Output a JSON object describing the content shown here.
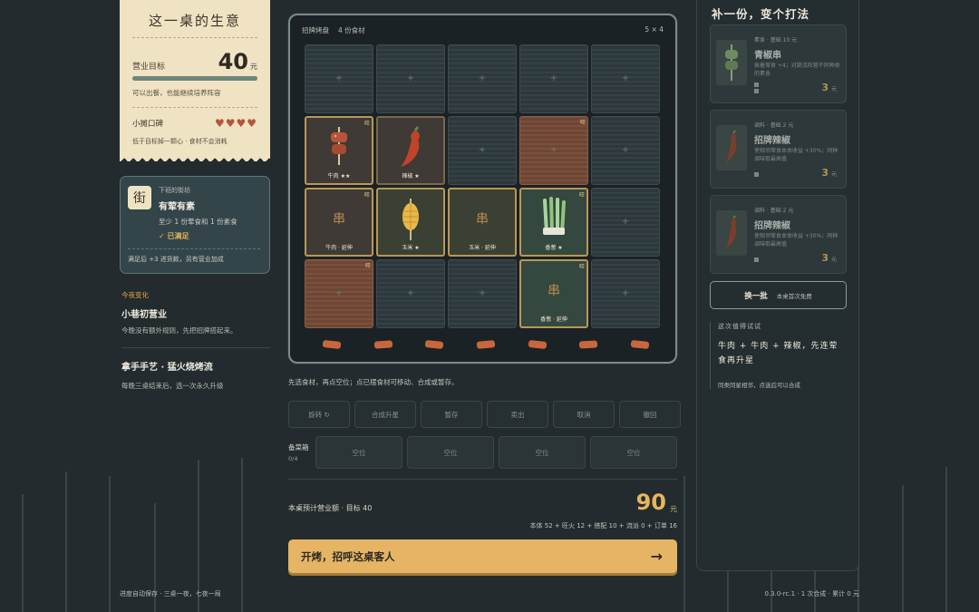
{
  "ticket": {
    "title": "这一桌的生意",
    "goal_label": "营业目标",
    "goal_value": "40",
    "goal_unit": "元",
    "goal_progress": 1.0,
    "goal_note": "可以出餐，也能继续培养阵容",
    "reputation_label": "小摊口碑",
    "hearts": "♥♥♥♥",
    "reputation_note": "低于目标掉一颗心 · 食材不会消耗"
  },
  "street": {
    "badge": "街",
    "small": "下班的街坊",
    "name": "有荤有素",
    "requirement": "至少 1 份荤食和 1 份素食",
    "status": "✓ 已满足",
    "bonus": "满足后 +3 进货款，另有营业加成"
  },
  "tonight": {
    "tag": "今夜变化",
    "title": "小巷初营业",
    "desc": "今晚没有额外规则，先把招牌搭起来。",
    "skill_title": "拿手手艺 · 猛火烧烤流",
    "skill_desc": "每晚三桌结束后，选一次永久升级"
  },
  "board": {
    "title": "招牌烤盘",
    "count": "4 份食材",
    "size": "5 × 4",
    "cells": [
      {
        "type": "empty"
      },
      {
        "type": "empty"
      },
      {
        "type": "empty"
      },
      {
        "type": "empty"
      },
      {
        "type": "empty"
      },
      {
        "type": "food",
        "style": "",
        "icon": "skewer-meat",
        "label": "牛肉 ★★",
        "corner": "旺"
      },
      {
        "type": "food",
        "style": "plain",
        "icon": "chili",
        "label": "辣椒 ★",
        "corner": ""
      },
      {
        "type": "empty"
      },
      {
        "type": "wood",
        "corner": "旺"
      },
      {
        "type": "empty"
      },
      {
        "type": "food",
        "style": "",
        "icon": "glyph",
        "glyph": "串",
        "label": "牛肉 · 延伸",
        "corner": "旺"
      },
      {
        "type": "food",
        "style": "olive",
        "icon": "corn",
        "label": "玉米 ★",
        "corner": ""
      },
      {
        "type": "food",
        "style": "olive",
        "icon": "glyph",
        "glyph": "串",
        "label": "玉米 · 延伸",
        "corner": ""
      },
      {
        "type": "food",
        "style": "green",
        "icon": "scallion",
        "label": "香葱 ★",
        "corner": "旺"
      },
      {
        "type": "empty"
      },
      {
        "type": "wood",
        "corner": "旺"
      },
      {
        "type": "empty"
      },
      {
        "type": "empty"
      },
      {
        "type": "food",
        "style": "green",
        "icon": "glyph",
        "glyph": "串",
        "label": "香葱 · 延伸",
        "corner": "旺"
      },
      {
        "type": "empty"
      }
    ]
  },
  "hint": "先选食材，再点空位；点已摆食材可移动、合成或暂存。",
  "actions": [
    "旋转 ↻",
    "合成升星",
    "暂存",
    "卖出",
    "取消",
    "撤回"
  ],
  "stash": {
    "label": "备菜箱",
    "count": "0/4",
    "slots": [
      "空位",
      "空位",
      "空位",
      "空位"
    ]
  },
  "estimate": {
    "label": "本桌预计营业额 · 目标 40",
    "value": "90",
    "unit": "元",
    "breakdown": "本体 52 + 旺火 12 + 搭配 10 + 流派 0 + 订单 16"
  },
  "go_button": {
    "label": "开烤，招呼这桌客人",
    "arrow": "→"
  },
  "shop": {
    "title": "补一份，变个打法",
    "cards": [
      {
        "tag": "素食 · 基础 10 元",
        "name": "青椒串",
        "desc": "挨着荤食 +4；对蔬流阵营不同种类的素食",
        "price": "3",
        "unit": "元"
      },
      {
        "tag": "调料 · 基础 2 元",
        "name": "招牌辣椒",
        "desc": "使相邻荤食本体收益 +30%；同种调味取最高值",
        "price": "3",
        "unit": "元"
      },
      {
        "tag": "调料 · 基础 2 元",
        "name": "招牌辣椒",
        "desc": "使相邻荤食本体收益 +30%；同种调味取最高值",
        "price": "3",
        "unit": "元"
      }
    ],
    "refresh_label": "换一批",
    "refresh_note": "本桌首次免费",
    "tip_title": "这次值得试试",
    "tip_body": "牛肉 + 牛肉 + 辣椒，先连荤食再升星",
    "tip_note": "同类同星相邻，点选后可以合成"
  },
  "footer": {
    "left": "进度自动保存 · 三桌一夜，七夜一局",
    "right": "0.3.0-rc.1 · 1 次合成 · 累计 0 元"
  }
}
